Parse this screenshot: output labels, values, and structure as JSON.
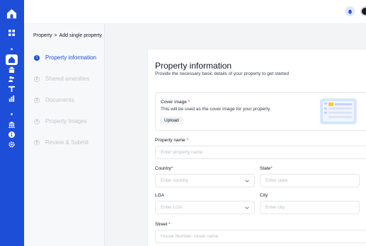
{
  "breadcrumb": {
    "parent": "Property",
    "separator": ">",
    "current": "Add single property"
  },
  "steps": [
    {
      "number": "1",
      "label": "Property information",
      "active": true
    },
    {
      "number": "2",
      "label": "Shared amenities",
      "active": false
    },
    {
      "number": "3",
      "label": "Documents",
      "active": false
    },
    {
      "number": "4",
      "label": "Property Images",
      "active": false
    },
    {
      "number": "5",
      "label": "Review & Submit",
      "active": false
    }
  ],
  "form": {
    "title": "Property information",
    "subtitle": "Provide the necessary basic details of your property to get started",
    "cover": {
      "title": "Cover image",
      "required_mark": "*",
      "description": "This will be used as the cover image for your property.",
      "upload_label": "Upload"
    },
    "fields": {
      "property_name": {
        "label": "Property name",
        "required": "*",
        "placeholder": "Enter property name",
        "value": ""
      },
      "country": {
        "label": "Country",
        "required": "*",
        "placeholder": "Enter country",
        "value": ""
      },
      "state": {
        "label": "State",
        "required": "*",
        "placeholder": "Enter state",
        "value": ""
      },
      "lga": {
        "label": "LGA",
        "required": "",
        "placeholder": "Enter LGA",
        "value": ""
      },
      "city": {
        "label": "City",
        "required": "",
        "placeholder": "Enter city",
        "value": ""
      },
      "street": {
        "label": "Street",
        "required": "*",
        "placeholder": "House Number, street name",
        "value": ""
      }
    }
  },
  "rail_icons": [
    "home-logo-icon",
    "dashboard-icon",
    "home-icon",
    "building-icon",
    "users-icon",
    "key-icon",
    "chart-icon",
    "bank-icon",
    "info-icon",
    "settings-icon"
  ],
  "header_icons": [
    "bell-icon",
    "avatar"
  ],
  "colors": {
    "primary": "#1d4ed8",
    "required": "#dc2626",
    "background": "#f3f4f6"
  }
}
